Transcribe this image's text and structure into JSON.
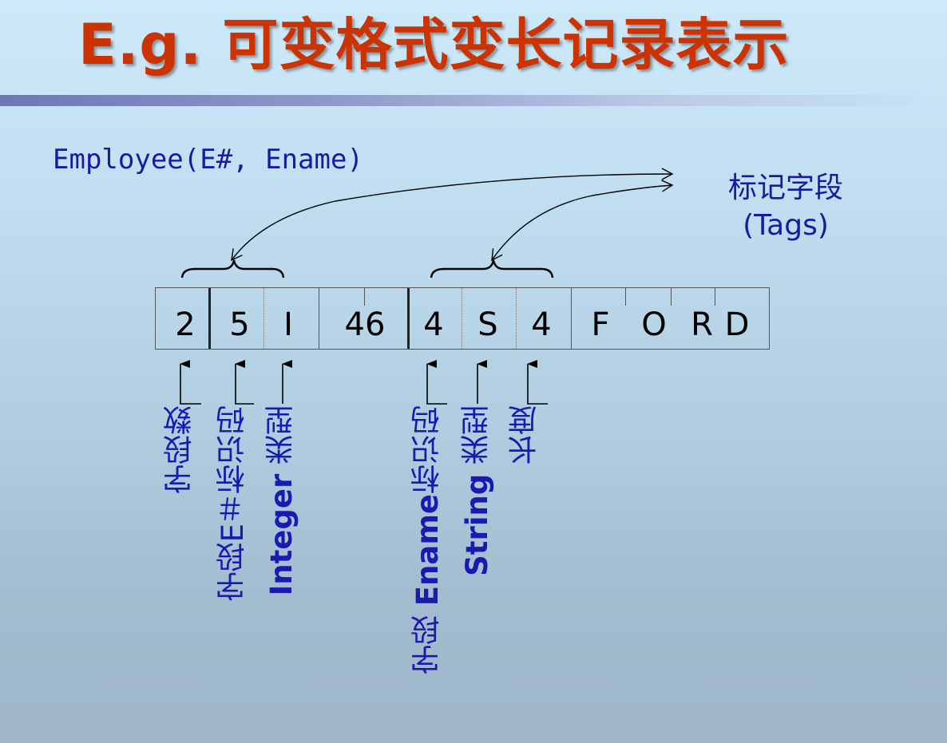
{
  "title": "E.g. 可变格式变长记录表示",
  "schema": "Employee(E#, Ename)",
  "tags": {
    "cn": "标记字段",
    "en": "(Tags)"
  },
  "record_cells": [
    "2",
    "5",
    "I",
    "46",
    "4",
    "S",
    "4",
    "F",
    "O",
    "R",
    "D"
  ],
  "labels": {
    "field_count": "字段数",
    "e_id_prefix": "字段E＃标识码",
    "int_type_en": "Integer",
    "int_type_cn": "类型",
    "ename_prefix": "字段",
    "ename_en": "Ename",
    "ename_suffix": "标识码",
    "string_en": "String",
    "string_cn": "类型",
    "length": "长度"
  },
  "colors": {
    "title": "#cc3300",
    "text": "#1a1aa0",
    "label": "#1a1ab0"
  }
}
